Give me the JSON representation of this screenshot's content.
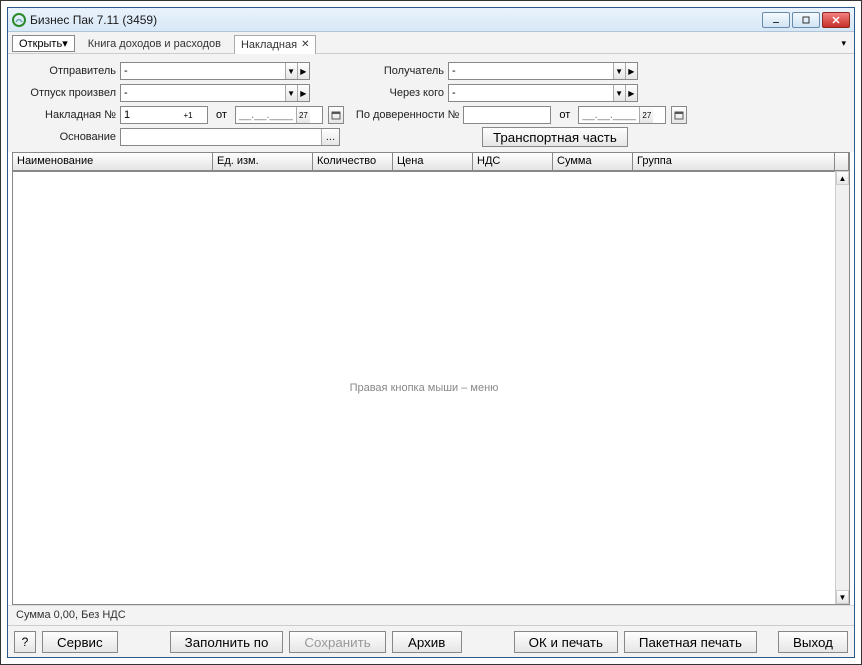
{
  "window": {
    "title": "Бизнес Пак 7.11 (3459)"
  },
  "tabs": {
    "open_label": "Открыть▾",
    "tab1": "Книга доходов и расходов",
    "tab2": "Накладная"
  },
  "form": {
    "sender_label": "Отправитель",
    "sender_value": "-",
    "receiver_label": "Получатель",
    "receiver_value": "-",
    "release_label": "Отпуск произвел",
    "release_value": "-",
    "via_label": "Через кого",
    "via_value": "-",
    "invoice_no_label": "Накладная №",
    "invoice_no_value": "1",
    "ot": "от",
    "date1_placeholder": "__.__.____",
    "date1_btn": "27",
    "proxy_label": "По доверенности №",
    "proxy_value": "",
    "date2_placeholder": "__.__.____",
    "date2_btn": "27",
    "basis_label": "Основание",
    "basis_value": "",
    "transport_btn": "Транспортная часть"
  },
  "table": {
    "cols": {
      "c1": "Наименование",
      "c2": "Ед. изм.",
      "c3": "Количество",
      "c4": "Цена",
      "c5": "НДС",
      "c6": "Сумма",
      "c7": "Группа"
    },
    "placeholder": "Правая кнопка мыши – меню"
  },
  "status": "Сумма 0,00, Без НДС",
  "bottom": {
    "help": "?",
    "service": "Сервис",
    "fill": "Заполнить по",
    "save": "Сохранить",
    "archive": "Архив",
    "ok_print": "ОК и печать",
    "batch_print": "Пакетная печать",
    "exit": "Выход"
  }
}
